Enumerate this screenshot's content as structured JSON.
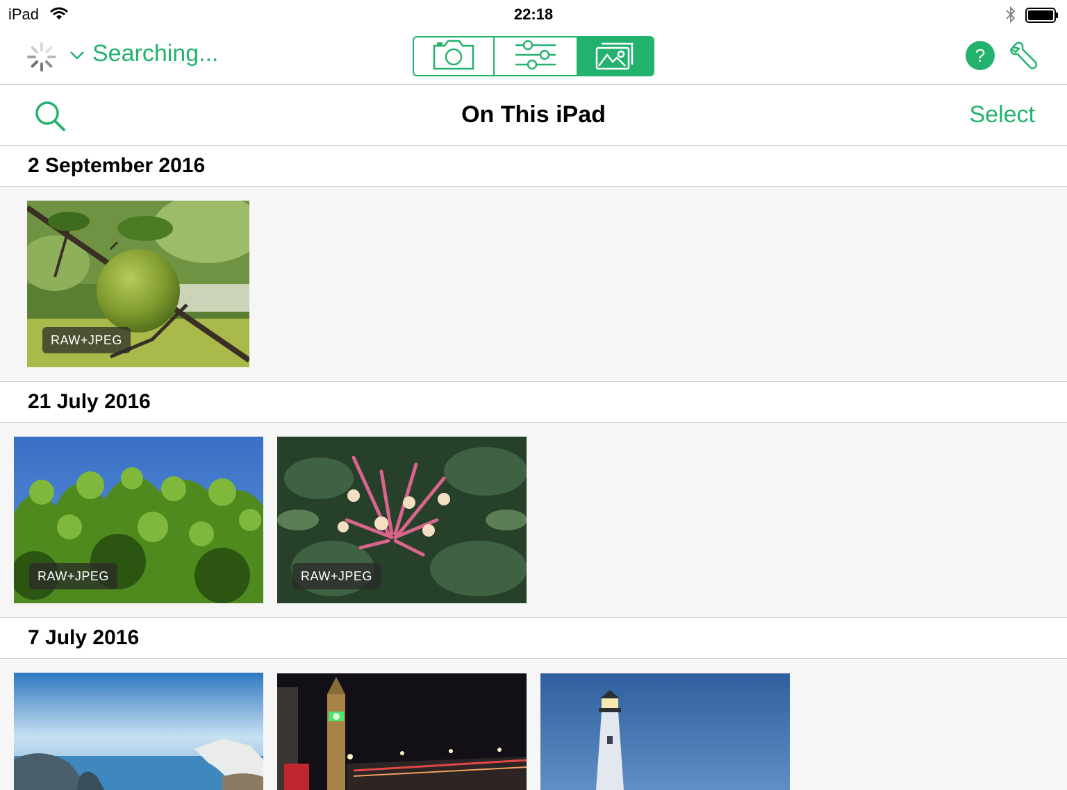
{
  "status_bar": {
    "device": "iPad",
    "time": "22:18"
  },
  "toolbar": {
    "status_text": "Searching...",
    "segments": [
      {
        "icon": "camera-icon",
        "selected": false
      },
      {
        "icon": "sliders-icon",
        "selected": false
      },
      {
        "icon": "photos-icon",
        "selected": true
      }
    ],
    "help_label": "?",
    "accent_color": "#23b26d"
  },
  "nav": {
    "title": "On This iPad",
    "select_label": "Select"
  },
  "sections": [
    {
      "date": "2 September 2016",
      "photos": [
        {
          "subject": "apple",
          "badge": "RAW+JPEG"
        }
      ]
    },
    {
      "date": "21 July 2016",
      "photos": [
        {
          "subject": "leaves",
          "badge": "RAW+JPEG"
        },
        {
          "subject": "honeysuckle",
          "badge": "RAW+JPEG"
        }
      ]
    },
    {
      "date": "7 July 2016",
      "photos": [
        {
          "subject": "coast-arch",
          "badge": ""
        },
        {
          "subject": "big-ben-night",
          "badge": ""
        },
        {
          "subject": "lighthouse",
          "badge": ""
        }
      ]
    }
  ]
}
